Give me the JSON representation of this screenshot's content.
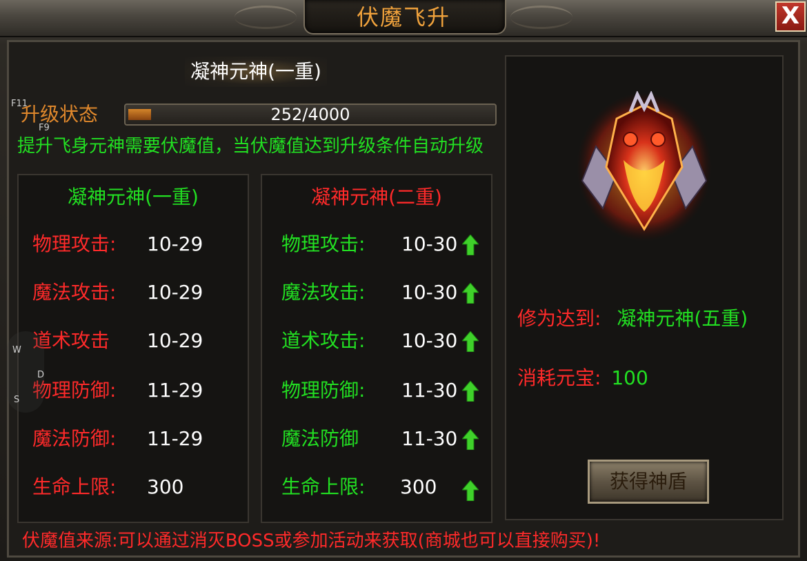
{
  "window": {
    "title": "伏魔飞升",
    "close_label": "X"
  },
  "header": {
    "level_title": "凝神元神(一重)",
    "status_label": "升级状态",
    "progress_text": "252/4000",
    "progress_fraction": 0.063,
    "tip": "提升飞身元神需要伏魔值，当伏魔值达到升级条件自动升级"
  },
  "current_panel": {
    "title": "凝神元神(一重)",
    "stats": [
      {
        "label": "物理攻击:",
        "value": "10-29"
      },
      {
        "label": "魔法攻击:",
        "value": "10-29"
      },
      {
        "label": "道术攻击",
        "value": "10-29"
      },
      {
        "label": "物理防御:",
        "value": "11-29"
      },
      {
        "label": "魔法防御:",
        "value": "11-29"
      },
      {
        "label": "生命上限:",
        "value": "300"
      }
    ]
  },
  "next_panel": {
    "title": "凝神元神(二重)",
    "stats": [
      {
        "label": "物理攻击:",
        "value": "10-30"
      },
      {
        "label": "魔法攻击:",
        "value": "10-30"
      },
      {
        "label": "道术攻击:",
        "value": "10-30"
      },
      {
        "label": "物理防御:",
        "value": "11-30"
      },
      {
        "label": "魔法防御",
        "value": "11-30"
      },
      {
        "label": "生命上限:",
        "value": "300"
      }
    ],
    "arrow_icon": "up-arrow-icon"
  },
  "reward_panel": {
    "requirement_label": "修为达到:",
    "requirement_value": "凝神元神(五重)",
    "cost_label": "消耗元宝:",
    "cost_value": "100",
    "button_label": "获得神盾",
    "item_icon": "divine-shield-icon"
  },
  "footer_note": "伏魔值来源:可以通过消灭BOSS或参加活动来获取(商城也可以直接购买)!",
  "hotkeys": [
    "F11",
    "F9",
    "W",
    "D",
    "S"
  ],
  "colors": {
    "title": "#f0a23c",
    "status_label": "#e0882c",
    "tip": "#22e022",
    "red_text": "#ff2a2a",
    "green_text": "#22e022",
    "close_button": "#b02a1e"
  }
}
